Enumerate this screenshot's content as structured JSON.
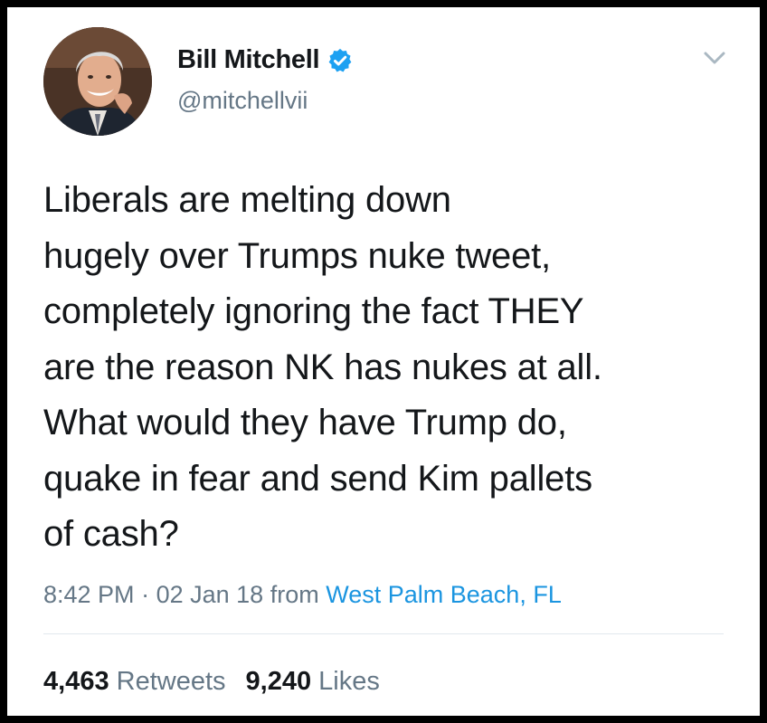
{
  "tweet": {
    "author": {
      "display_name": "Bill Mitchell",
      "handle": "@mitchellvii",
      "verified": true,
      "avatar_icon": "profile-photo-man-in-suit"
    },
    "menu_icon": "chevron-down-icon",
    "text": "Liberals are melting down\nhugely over Trumps nuke tweet,\ncompletely ignoring the fact THEY\nare the reason NK has nukes at all.\nWhat would they have Trump do,\nquake in fear and send Kim pallets\nof cash?",
    "time": "8:42 PM",
    "separator": "·",
    "date": "02 Jan 18",
    "from_label": "from",
    "location": "West Palm Beach, FL",
    "stats": {
      "retweets_count": "4,463",
      "retweets_label": "Retweets",
      "likes_count": "9,240",
      "likes_label": "Likes"
    }
  },
  "colors": {
    "text_primary": "#14171a",
    "text_secondary": "#657786",
    "link": "#1b95e0",
    "verified_badge": "#1da1f2",
    "frame": "#000000"
  }
}
